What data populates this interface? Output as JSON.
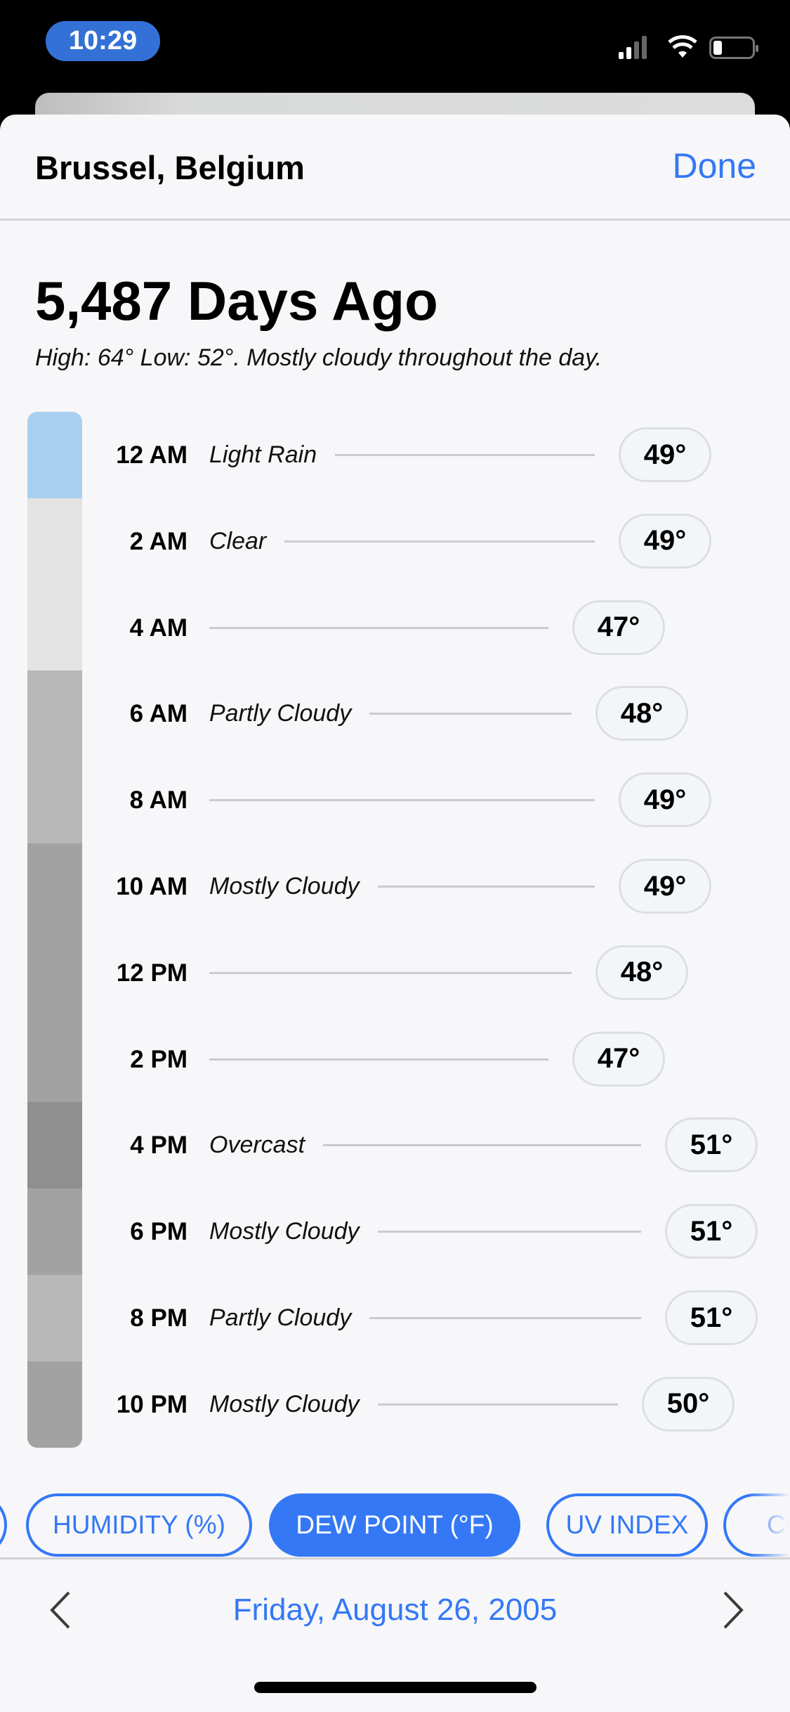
{
  "status_bar": {
    "time": "10:29",
    "icons": [
      "cellular-signal-icon",
      "wifi-icon",
      "battery-low-icon"
    ]
  },
  "header": {
    "title": "Brussel, Belgium",
    "done_label": "Done"
  },
  "summary": {
    "headline": "5,487 Days Ago",
    "description": "High: 64° Low: 52°. Mostly cloudy throughout the day."
  },
  "hours": [
    {
      "time": "12 AM",
      "condition": "Light Rain",
      "value": 49,
      "label": "49°",
      "color": "#a9cff0"
    },
    {
      "time": "2 AM",
      "condition": "Clear",
      "value": 49,
      "label": "49°",
      "color": "#e3e3e3"
    },
    {
      "time": "4 AM",
      "condition": "",
      "value": 47,
      "label": "47°",
      "color": "#e3e3e3"
    },
    {
      "time": "6 AM",
      "condition": "Partly Cloudy",
      "value": 48,
      "label": "48°",
      "color": "#b8b8b8"
    },
    {
      "time": "8 AM",
      "condition": "",
      "value": 49,
      "label": "49°",
      "color": "#b8b8b8"
    },
    {
      "time": "10 AM",
      "condition": "Mostly Cloudy",
      "value": 49,
      "label": "49°",
      "color": "#a2a2a2"
    },
    {
      "time": "12 PM",
      "condition": "",
      "value": 48,
      "label": "48°",
      "color": "#a2a2a2"
    },
    {
      "time": "2 PM",
      "condition": "",
      "value": 47,
      "label": "47°",
      "color": "#a2a2a2"
    },
    {
      "time": "4 PM",
      "condition": "Overcast",
      "value": 51,
      "label": "51°",
      "color": "#8f8f8f"
    },
    {
      "time": "6 PM",
      "condition": "Mostly Cloudy",
      "value": 51,
      "label": "51°",
      "color": "#a2a2a2"
    },
    {
      "time": "8 PM",
      "condition": "Partly Cloudy",
      "value": 51,
      "label": "51°",
      "color": "#b8b8b8"
    },
    {
      "time": "10 PM",
      "condition": "Mostly Cloudy",
      "value": 50,
      "label": "50°",
      "color": "#a2a2a2"
    }
  ],
  "metric_tabs": [
    {
      "label": "",
      "selected": false
    },
    {
      "label": "HUMIDITY (%)",
      "selected": false
    },
    {
      "label": "DEW POINT (°F)",
      "selected": true
    },
    {
      "label": "UV INDEX",
      "selected": false
    },
    {
      "label": "CLO",
      "selected": false
    }
  ],
  "footer": {
    "date": "Friday, August 26, 2005",
    "prev_icon": "chevron-left-icon",
    "next_icon": "chevron-right-icon"
  },
  "colors": {
    "accent": "#3478f6",
    "time_pill": "#3371d6"
  }
}
